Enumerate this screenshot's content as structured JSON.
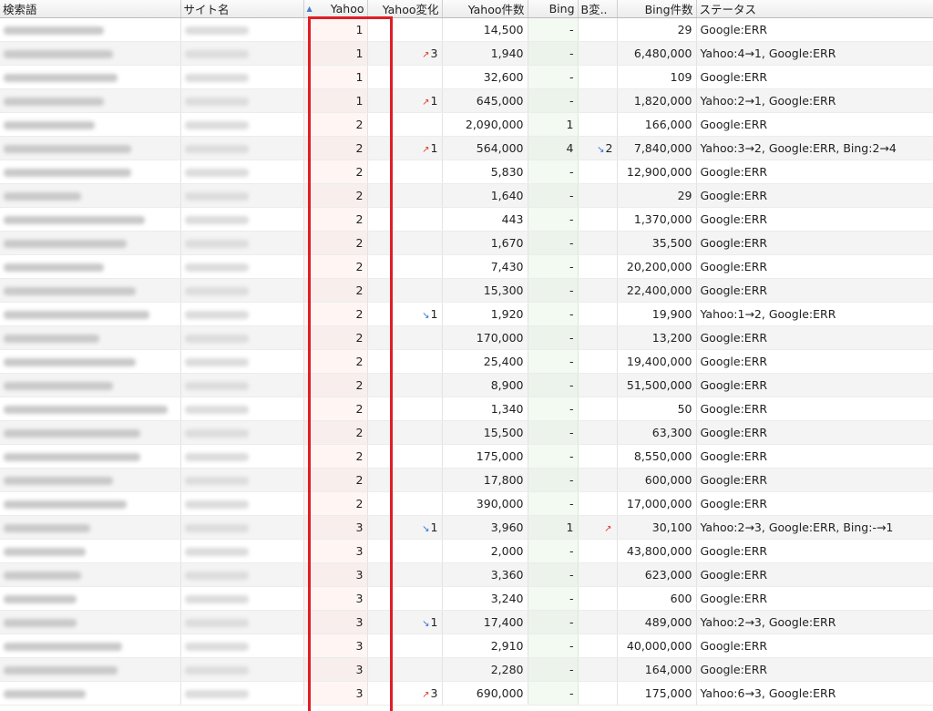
{
  "headers": {
    "keyword": "検索語",
    "site": "サイト名",
    "yahoo": "Yahoo",
    "yahoo_change": "Yahoo変化",
    "yahoo_count": "Yahoo件数",
    "bing": "Bing",
    "bing_change": "B変..",
    "bing_count": "Bing件数",
    "status": "ステータス"
  },
  "colors": {
    "up": "#e23b2a",
    "down": "#2f6fd8",
    "highlight": "#e01d26"
  },
  "rows": [
    {
      "yahoo": "1",
      "ychg": "",
      "ydir": "",
      "ycount": "14,500",
      "bing": "-",
      "bchg": "",
      "bdir": "",
      "bcount": "29",
      "status": "Google:ERR",
      "kw": 110,
      "site": 70
    },
    {
      "yahoo": "1",
      "ychg": "3",
      "ydir": "up",
      "ycount": "1,940",
      "bing": "-",
      "bchg": "",
      "bdir": "",
      "bcount": "6,480,000",
      "status": "Yahoo:4→1, Google:ERR",
      "kw": 120,
      "site": 70
    },
    {
      "yahoo": "1",
      "ychg": "",
      "ydir": "",
      "ycount": "32,600",
      "bing": "-",
      "bchg": "",
      "bdir": "",
      "bcount": "109",
      "status": "Google:ERR",
      "kw": 125,
      "site": 70
    },
    {
      "yahoo": "1",
      "ychg": "1",
      "ydir": "up",
      "ycount": "645,000",
      "bing": "-",
      "bchg": "",
      "bdir": "",
      "bcount": "1,820,000",
      "status": "Yahoo:2→1, Google:ERR",
      "kw": 110,
      "site": 70
    },
    {
      "yahoo": "2",
      "ychg": "",
      "ydir": "",
      "ycount": "2,090,000",
      "bing": "1",
      "bchg": "",
      "bdir": "",
      "bcount": "166,000",
      "status": "Google:ERR",
      "kw": 100,
      "site": 70
    },
    {
      "yahoo": "2",
      "ychg": "1",
      "ydir": "up",
      "ycount": "564,000",
      "bing": "4",
      "bchg": "2",
      "bdir": "down",
      "bcount": "7,840,000",
      "status": "Yahoo:3→2, Google:ERR, Bing:2→4",
      "kw": 140,
      "site": 70
    },
    {
      "yahoo": "2",
      "ychg": "",
      "ydir": "",
      "ycount": "5,830",
      "bing": "-",
      "bchg": "",
      "bdir": "",
      "bcount": "12,900,000",
      "status": "Google:ERR",
      "kw": 140,
      "site": 70
    },
    {
      "yahoo": "2",
      "ychg": "",
      "ydir": "",
      "ycount": "1,640",
      "bing": "-",
      "bchg": "",
      "bdir": "",
      "bcount": "29",
      "status": "Google:ERR",
      "kw": 85,
      "site": 70
    },
    {
      "yahoo": "2",
      "ychg": "",
      "ydir": "",
      "ycount": "443",
      "bing": "-",
      "bchg": "",
      "bdir": "",
      "bcount": "1,370,000",
      "status": "Google:ERR",
      "kw": 155,
      "site": 70
    },
    {
      "yahoo": "2",
      "ychg": "",
      "ydir": "",
      "ycount": "1,670",
      "bing": "-",
      "bchg": "",
      "bdir": "",
      "bcount": "35,500",
      "status": "Google:ERR",
      "kw": 135,
      "site": 70
    },
    {
      "yahoo": "2",
      "ychg": "",
      "ydir": "",
      "ycount": "7,430",
      "bing": "-",
      "bchg": "",
      "bdir": "",
      "bcount": "20,200,000",
      "status": "Google:ERR",
      "kw": 110,
      "site": 70
    },
    {
      "yahoo": "2",
      "ychg": "",
      "ydir": "",
      "ycount": "15,300",
      "bing": "-",
      "bchg": "",
      "bdir": "",
      "bcount": "22,400,000",
      "status": "Google:ERR",
      "kw": 145,
      "site": 70
    },
    {
      "yahoo": "2",
      "ychg": "1",
      "ydir": "down",
      "ycount": "1,920",
      "bing": "-",
      "bchg": "",
      "bdir": "",
      "bcount": "19,900",
      "status": "Yahoo:1→2, Google:ERR",
      "kw": 160,
      "site": 70
    },
    {
      "yahoo": "2",
      "ychg": "",
      "ydir": "",
      "ycount": "170,000",
      "bing": "-",
      "bchg": "",
      "bdir": "",
      "bcount": "13,200",
      "status": "Google:ERR",
      "kw": 105,
      "site": 70
    },
    {
      "yahoo": "2",
      "ychg": "",
      "ydir": "",
      "ycount": "25,400",
      "bing": "-",
      "bchg": "",
      "bdir": "",
      "bcount": "19,400,000",
      "status": "Google:ERR",
      "kw": 145,
      "site": 70
    },
    {
      "yahoo": "2",
      "ychg": "",
      "ydir": "",
      "ycount": "8,900",
      "bing": "-",
      "bchg": "",
      "bdir": "",
      "bcount": "51,500,000",
      "status": "Google:ERR",
      "kw": 120,
      "site": 70
    },
    {
      "yahoo": "2",
      "ychg": "",
      "ydir": "",
      "ycount": "1,340",
      "bing": "-",
      "bchg": "",
      "bdir": "",
      "bcount": "50",
      "status": "Google:ERR",
      "kw": 180,
      "site": 70
    },
    {
      "yahoo": "2",
      "ychg": "",
      "ydir": "",
      "ycount": "15,500",
      "bing": "-",
      "bchg": "",
      "bdir": "",
      "bcount": "63,300",
      "status": "Google:ERR",
      "kw": 150,
      "site": 70
    },
    {
      "yahoo": "2",
      "ychg": "",
      "ydir": "",
      "ycount": "175,000",
      "bing": "-",
      "bchg": "",
      "bdir": "",
      "bcount": "8,550,000",
      "status": "Google:ERR",
      "kw": 150,
      "site": 70
    },
    {
      "yahoo": "2",
      "ychg": "",
      "ydir": "",
      "ycount": "17,800",
      "bing": "-",
      "bchg": "",
      "bdir": "",
      "bcount": "600,000",
      "status": "Google:ERR",
      "kw": 120,
      "site": 70
    },
    {
      "yahoo": "2",
      "ychg": "",
      "ydir": "",
      "ycount": "390,000",
      "bing": "-",
      "bchg": "",
      "bdir": "",
      "bcount": "17,000,000",
      "status": "Google:ERR",
      "kw": 135,
      "site": 70
    },
    {
      "yahoo": "3",
      "ychg": "1",
      "ydir": "down",
      "ycount": "3,960",
      "bing": "1",
      "bchg": "",
      "bdir": "up",
      "bcount": "30,100",
      "status": "Yahoo:2→3, Google:ERR, Bing:-→1",
      "kw": 95,
      "site": 70
    },
    {
      "yahoo": "3",
      "ychg": "",
      "ydir": "",
      "ycount": "2,000",
      "bing": "-",
      "bchg": "",
      "bdir": "",
      "bcount": "43,800,000",
      "status": "Google:ERR",
      "kw": 90,
      "site": 70
    },
    {
      "yahoo": "3",
      "ychg": "",
      "ydir": "",
      "ycount": "3,360",
      "bing": "-",
      "bchg": "",
      "bdir": "",
      "bcount": "623,000",
      "status": "Google:ERR",
      "kw": 85,
      "site": 70
    },
    {
      "yahoo": "3",
      "ychg": "",
      "ydir": "",
      "ycount": "3,240",
      "bing": "-",
      "bchg": "",
      "bdir": "",
      "bcount": "600",
      "status": "Google:ERR",
      "kw": 80,
      "site": 70
    },
    {
      "yahoo": "3",
      "ychg": "1",
      "ydir": "down",
      "ycount": "17,400",
      "bing": "-",
      "bchg": "",
      "bdir": "",
      "bcount": "489,000",
      "status": "Yahoo:2→3, Google:ERR",
      "kw": 80,
      "site": 70
    },
    {
      "yahoo": "3",
      "ychg": "",
      "ydir": "",
      "ycount": "2,910",
      "bing": "-",
      "bchg": "",
      "bdir": "",
      "bcount": "40,000,000",
      "status": "Google:ERR",
      "kw": 130,
      "site": 70
    },
    {
      "yahoo": "3",
      "ychg": "",
      "ydir": "",
      "ycount": "2,280",
      "bing": "-",
      "bchg": "",
      "bdir": "",
      "bcount": "164,000",
      "status": "Google:ERR",
      "kw": 125,
      "site": 70
    },
    {
      "yahoo": "3",
      "ychg": "3",
      "ydir": "up",
      "ycount": "690,000",
      "bing": "-",
      "bchg": "",
      "bdir": "",
      "bcount": "175,000",
      "status": "Yahoo:6→3, Google:ERR",
      "kw": 90,
      "site": 70
    }
  ]
}
